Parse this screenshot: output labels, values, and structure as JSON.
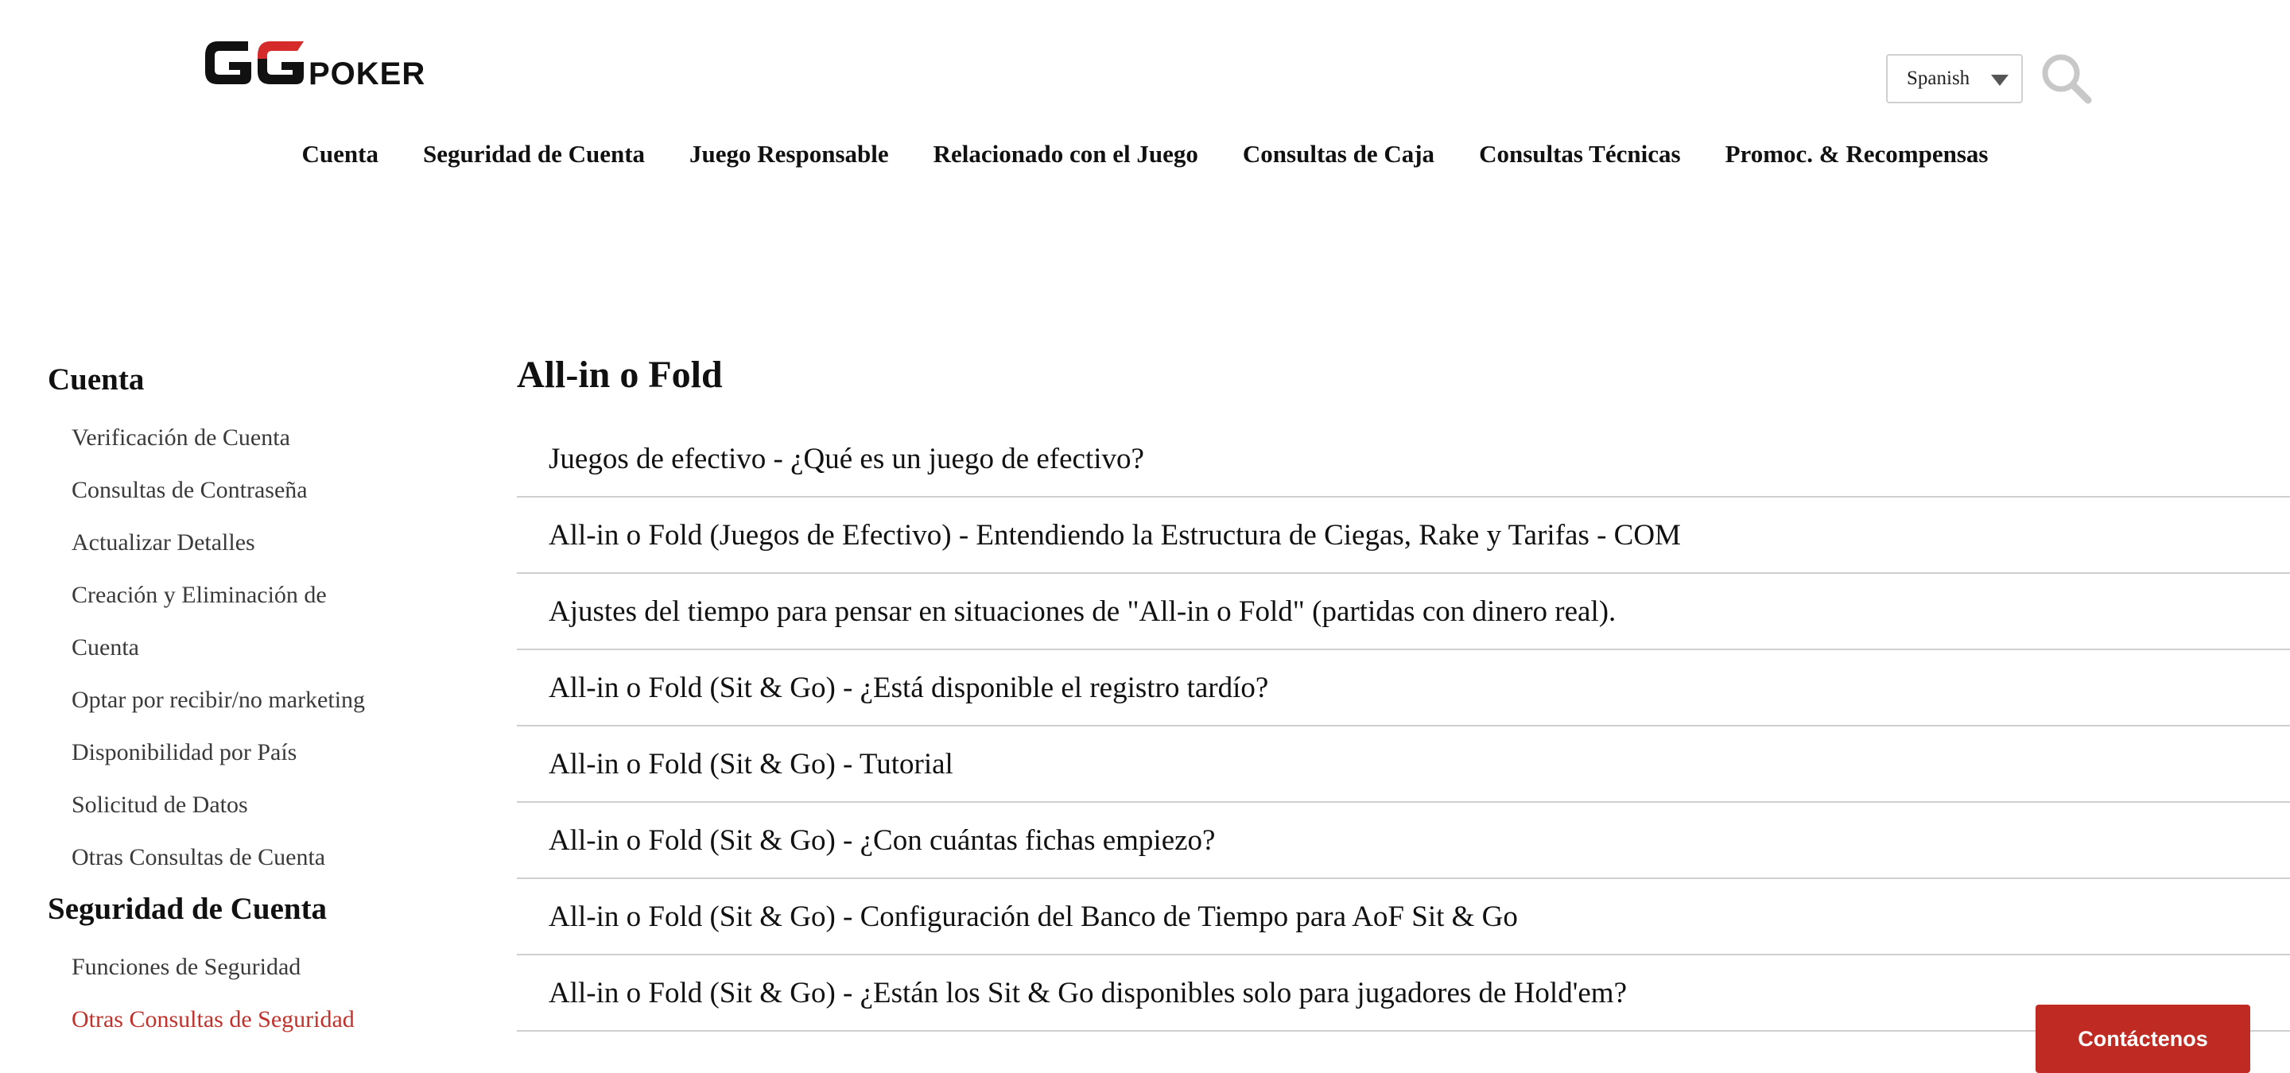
{
  "header": {
    "logo_text": "GGPOKER",
    "language": {
      "selected": "Spanish"
    },
    "search_icon": "search-icon"
  },
  "top_nav": [
    {
      "label": "Cuenta"
    },
    {
      "label": "Seguridad de Cuenta"
    },
    {
      "label": "Juego Responsable"
    },
    {
      "label": "Relacionado con el Juego"
    },
    {
      "label": "Consultas de Caja"
    },
    {
      "label": "Consultas Técnicas"
    },
    {
      "label": "Promoc. & Recompensas"
    }
  ],
  "sidebar": {
    "sections": [
      {
        "heading": "Cuenta",
        "items": [
          "Verificación de Cuenta",
          "Consultas de Contraseña",
          "Actualizar Detalles",
          "Creación y Eliminación de",
          "Cuenta",
          "Optar por recibir/no marketing",
          "Disponibilidad por País",
          "Solicitud de Datos",
          "Otras Consultas de Cuenta"
        ]
      },
      {
        "heading": "Seguridad de Cuenta",
        "items": [
          "Funciones de Seguridad",
          "Otras Consultas de Seguridad"
        ]
      }
    ],
    "active_item": "Otras Consultas de Seguridad"
  },
  "main": {
    "title": "All-in o Fold",
    "articles": [
      "Juegos de efectivo - ¿Qué es un juego de efectivo?",
      "All-in o Fold (Juegos de Efectivo) - Entendiendo la Estructura de Ciegas, Rake y Tarifas - COM",
      "Ajustes del tiempo para pensar en situaciones de \"All-in o Fold\" (partidas con dinero real).",
      "All-in o Fold (Sit & Go) - ¿Está disponible el registro tardío?",
      "All-in o Fold (Sit & Go) - Tutorial",
      "All-in o Fold (Sit & Go) - ¿Con cuántas fichas empiezo?",
      "All-in o Fold (Sit & Go) - Configuración del Banco de Tiempo para AoF Sit & Go",
      "All-in o Fold (Sit & Go) - ¿Están los Sit & Go disponibles solo para jugadores de Hold'em?"
    ]
  },
  "contact_button": {
    "label": "Contáctenos"
  },
  "colors": {
    "accent": "#bf2a22",
    "active_link": "#c0322b",
    "divider": "#cfcfcf"
  }
}
